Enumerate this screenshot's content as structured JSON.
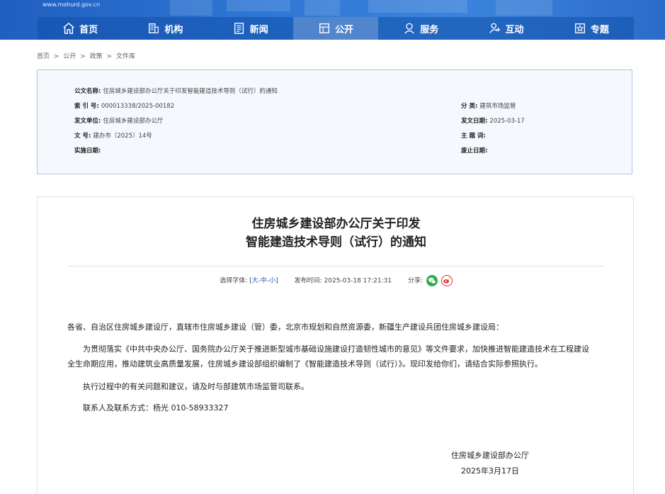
{
  "site": {
    "url": "www.mohurd.gov.cn"
  },
  "nav": [
    {
      "label": "首页",
      "icon": "home-icon"
    },
    {
      "label": "机构",
      "icon": "building-icon"
    },
    {
      "label": "新闻",
      "icon": "news-icon"
    },
    {
      "label": "公开",
      "icon": "disclosure-icon",
      "active": true
    },
    {
      "label": "服务",
      "icon": "service-icon"
    },
    {
      "label": "互动",
      "icon": "interaction-icon"
    },
    {
      "label": "专题",
      "icon": "topic-icon"
    }
  ],
  "breadcrumb": [
    "首页",
    ">",
    "公开",
    ">",
    "政策",
    ">",
    "文件库"
  ],
  "meta": {
    "title_label": "公文名称:",
    "title_value": "住房城乡建设部办公厅关于印发智能建造技术导则（试行）的通知",
    "index_label": "索  引  号:",
    "index_value": "000013338/2025-00182",
    "unit_label": "发文单位:",
    "unit_value": "住房城乡建设部办公厅",
    "number_label": "文      号:",
    "number_value": "建办市〔2025〕14号",
    "impl_label": "实施日期:",
    "impl_value": "",
    "category_label": "分      类:",
    "category_value": "建筑市场监管",
    "date_label": "发文日期:",
    "date_value": "2025-03-17",
    "keyword_label": "主  题  词:",
    "keyword_value": "",
    "abolish_label": "废止日期:",
    "abolish_value": ""
  },
  "article": {
    "title_line1": "住房城乡建设部办公厅关于印发",
    "title_line2": "智能建造技术导则（试行）的通知",
    "font_label": "选择字体:",
    "font_open": "[",
    "font_large": "大",
    "font_medium": "中",
    "font_small": "小",
    "font_dash": "-",
    "font_close": "]",
    "publish_label": "发布时间:",
    "publish_time": "2025-03-18 17:21:31",
    "share_label": "分享:",
    "addressee": "各省、自治区住房城乡建设厅，直辖市住房城乡建设（管）委，北京市规划和自然资源委，新疆生产建设兵团住房城乡建设局：",
    "para1_line1": "为贯彻落实《中共中央办公厅、国务院办公厅关于推进新型城市基础设施建设打造韧性城市的意见》等文件要求，加快推进智能建造技术在工程建设",
    "para1_line2": "全生命期应用，推动建筑业高质量发展，住房城乡建设部组织编制了《智能建造技术导则（试行）》。现印发给你们，请结合实际参照执行。",
    "para2": "执行过程中的有关问题和建议，请及时与部建筑市场监管司联系。",
    "contact": "联系人及联系方式：杨光   010-58933327",
    "sign_org": "住房城乡建设部办公厅",
    "sign_date": "2025年3月17日"
  },
  "colors": {
    "nav_bg": "#2f77d4",
    "meta_border": "#a9c6e6",
    "meta_bg": "#f5f9fe",
    "link": "#1a5fb4",
    "wechat": "#2aae47",
    "weibo": "#e0332f"
  }
}
